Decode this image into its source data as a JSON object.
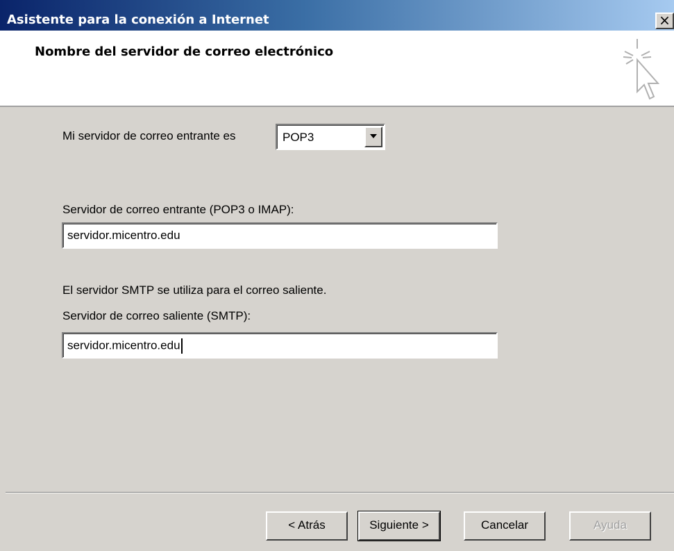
{
  "window": {
    "title": "Asistente para la conexión a Internet",
    "close_label": "×"
  },
  "header": {
    "title": "Nombre del servidor de correo electrónico",
    "icon": "wizard-cursor-sparkle-icon"
  },
  "form": {
    "incoming_type_label": "Mi servidor de correo entrante es",
    "incoming_type_value": "POP3",
    "incoming_server_label": "Servidor de correo entrante (POP3 o IMAP):",
    "incoming_server_value": "servidor.micentro.edu",
    "smtp_note": "El servidor SMTP se utiliza para el correo saliente.",
    "outgoing_server_label": "Servidor de correo saliente (SMTP):",
    "outgoing_server_value": "servidor.micentro.edu"
  },
  "buttons": {
    "back": "< Atrás",
    "next": "Siguiente >",
    "cancel": "Cancelar",
    "help": "Ayuda"
  }
}
